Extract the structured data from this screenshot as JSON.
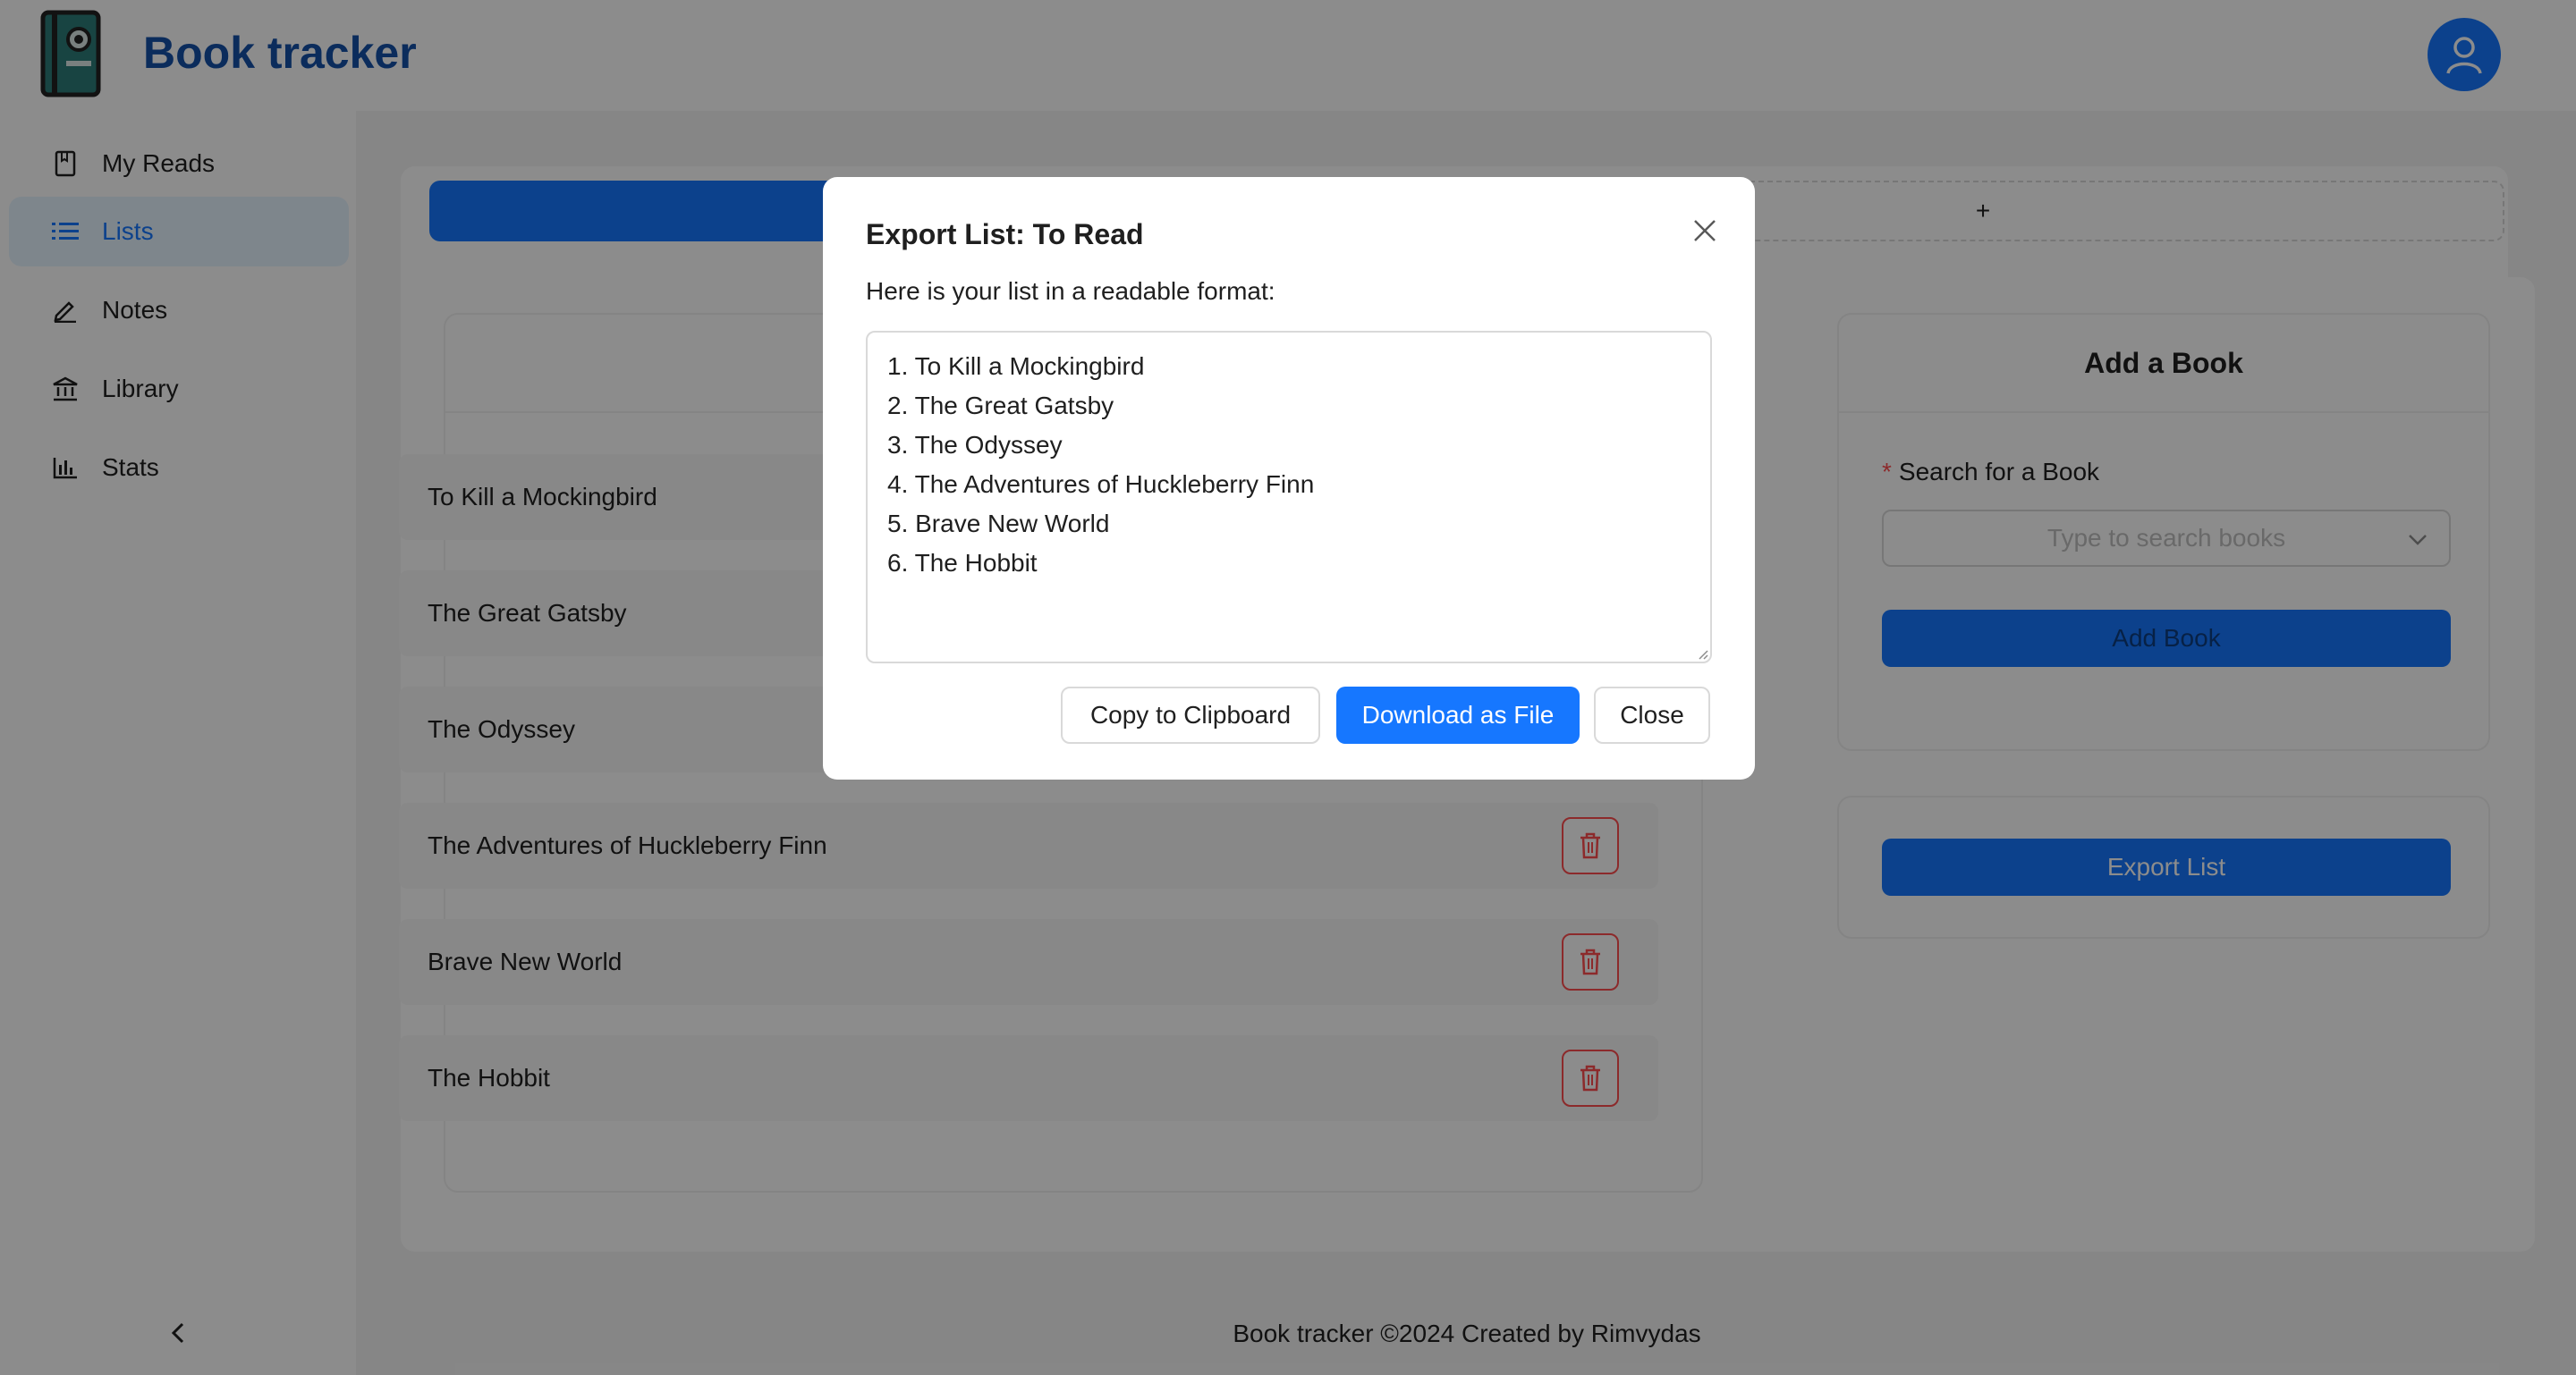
{
  "header": {
    "app_title": "Book tracker",
    "logo_icon": "book-camera-icon",
    "avatar_icon": "user-icon"
  },
  "sidebar": {
    "items": [
      {
        "label": "My Reads",
        "icon": "book-icon",
        "active": false
      },
      {
        "label": "Lists",
        "icon": "list-icon",
        "active": true
      },
      {
        "label": "Notes",
        "icon": "pen-icon",
        "active": false
      },
      {
        "label": "Library",
        "icon": "bank-icon",
        "active": false
      },
      {
        "label": "Stats",
        "icon": "bar-chart-icon",
        "active": false
      }
    ],
    "collapse_icon": "chevron-left-icon"
  },
  "tabs": {
    "add_label": "+"
  },
  "book_list": {
    "items": [
      {
        "title": "To Kill a Mockingbird"
      },
      {
        "title": "The Great Gatsby"
      },
      {
        "title": "The Odyssey"
      },
      {
        "title": "The Adventures of Huckleberry Finn"
      },
      {
        "title": "Brave New World"
      },
      {
        "title": "The Hobbit"
      }
    ],
    "delete_icon": "trash-icon"
  },
  "add_book": {
    "title": "Add a Book",
    "required_mark": "*",
    "search_label": "Search for a Book",
    "search_placeholder": "Type to search books",
    "add_button": "Add Book"
  },
  "export_card": {
    "export_button": "Export List"
  },
  "footer": {
    "text": "Book tracker ©2024 Created by Rimvydas"
  },
  "modal": {
    "title": "Export List: To Read",
    "description": "Here is your list in a readable format:",
    "export_text": "1. To Kill a Mockingbird\n2. The Great Gatsby\n3. The Odyssey\n4. The Adventures of Huckleberry Finn\n5. Brave New World\n6. The Hobbit",
    "copy_button": "Copy to Clipboard",
    "download_button": "Download as File",
    "close_button": "Close",
    "close_icon": "close-icon"
  },
  "colors": {
    "primary": "#1677ff",
    "brand_title": "#1450a8",
    "danger": "#ff4d4f",
    "active_bg": "#e6f4ff"
  }
}
